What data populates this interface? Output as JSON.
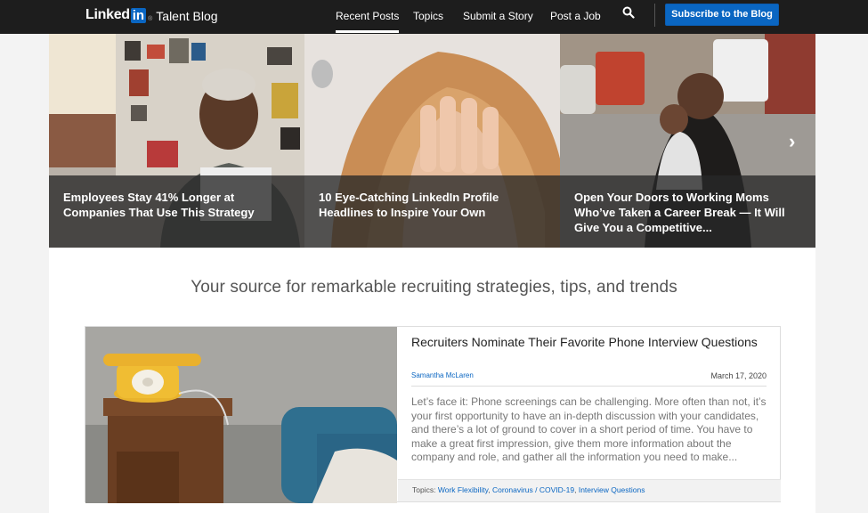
{
  "brand": {
    "wordmark": "Linked",
    "in_badge": "in",
    "registered": "®",
    "blog_name": "Talent Blog"
  },
  "nav": {
    "items": [
      {
        "label": "Recent Posts",
        "active": true
      },
      {
        "label": "Topics",
        "active": false
      },
      {
        "label": "Submit a Story",
        "active": false
      },
      {
        "label": "Post a Job",
        "active": false
      }
    ],
    "search_icon": "search-icon",
    "subscribe_label": "Subscribe to the Blog"
  },
  "carousel": {
    "slides": [
      {
        "title": "Employees Stay 41% Longer at Companies That Use This Strategy"
      },
      {
        "title": "10 Eye-Catching LinkedIn Profile Headlines to Inspire Your Own"
      },
      {
        "title": "Open Your Doors to Working Moms Who’ve Taken a Career Break — It Will Give You a Competitive..."
      }
    ],
    "next_icon": "chevron-right-icon"
  },
  "tagline": "Your source for remarkable recruiting strategies, tips, and trends",
  "featured": {
    "title": "Recruiters Nominate Their Favorite Phone Interview Questions",
    "author": "Samantha McLaren",
    "date": "March 17, 2020",
    "excerpt": "Let’s face it: Phone screenings can be challenging. More often than not, it’s your first opportunity to have an in-depth discussion with your candidates, and there’s a lot of ground to cover in a short period of time. You have to make a great first impression, give them more information about the company and role, and gather all the information you need to make...",
    "topics_label": "Topics:",
    "topics": [
      "Work Flexibility",
      "Coronavirus / COVID-19",
      "Interview Questions"
    ],
    "topic_separator": ","
  },
  "colors": {
    "nav_bg": "#1d1d1d",
    "accent": "#0a66c2",
    "page_bg": "#f3f3f3"
  }
}
